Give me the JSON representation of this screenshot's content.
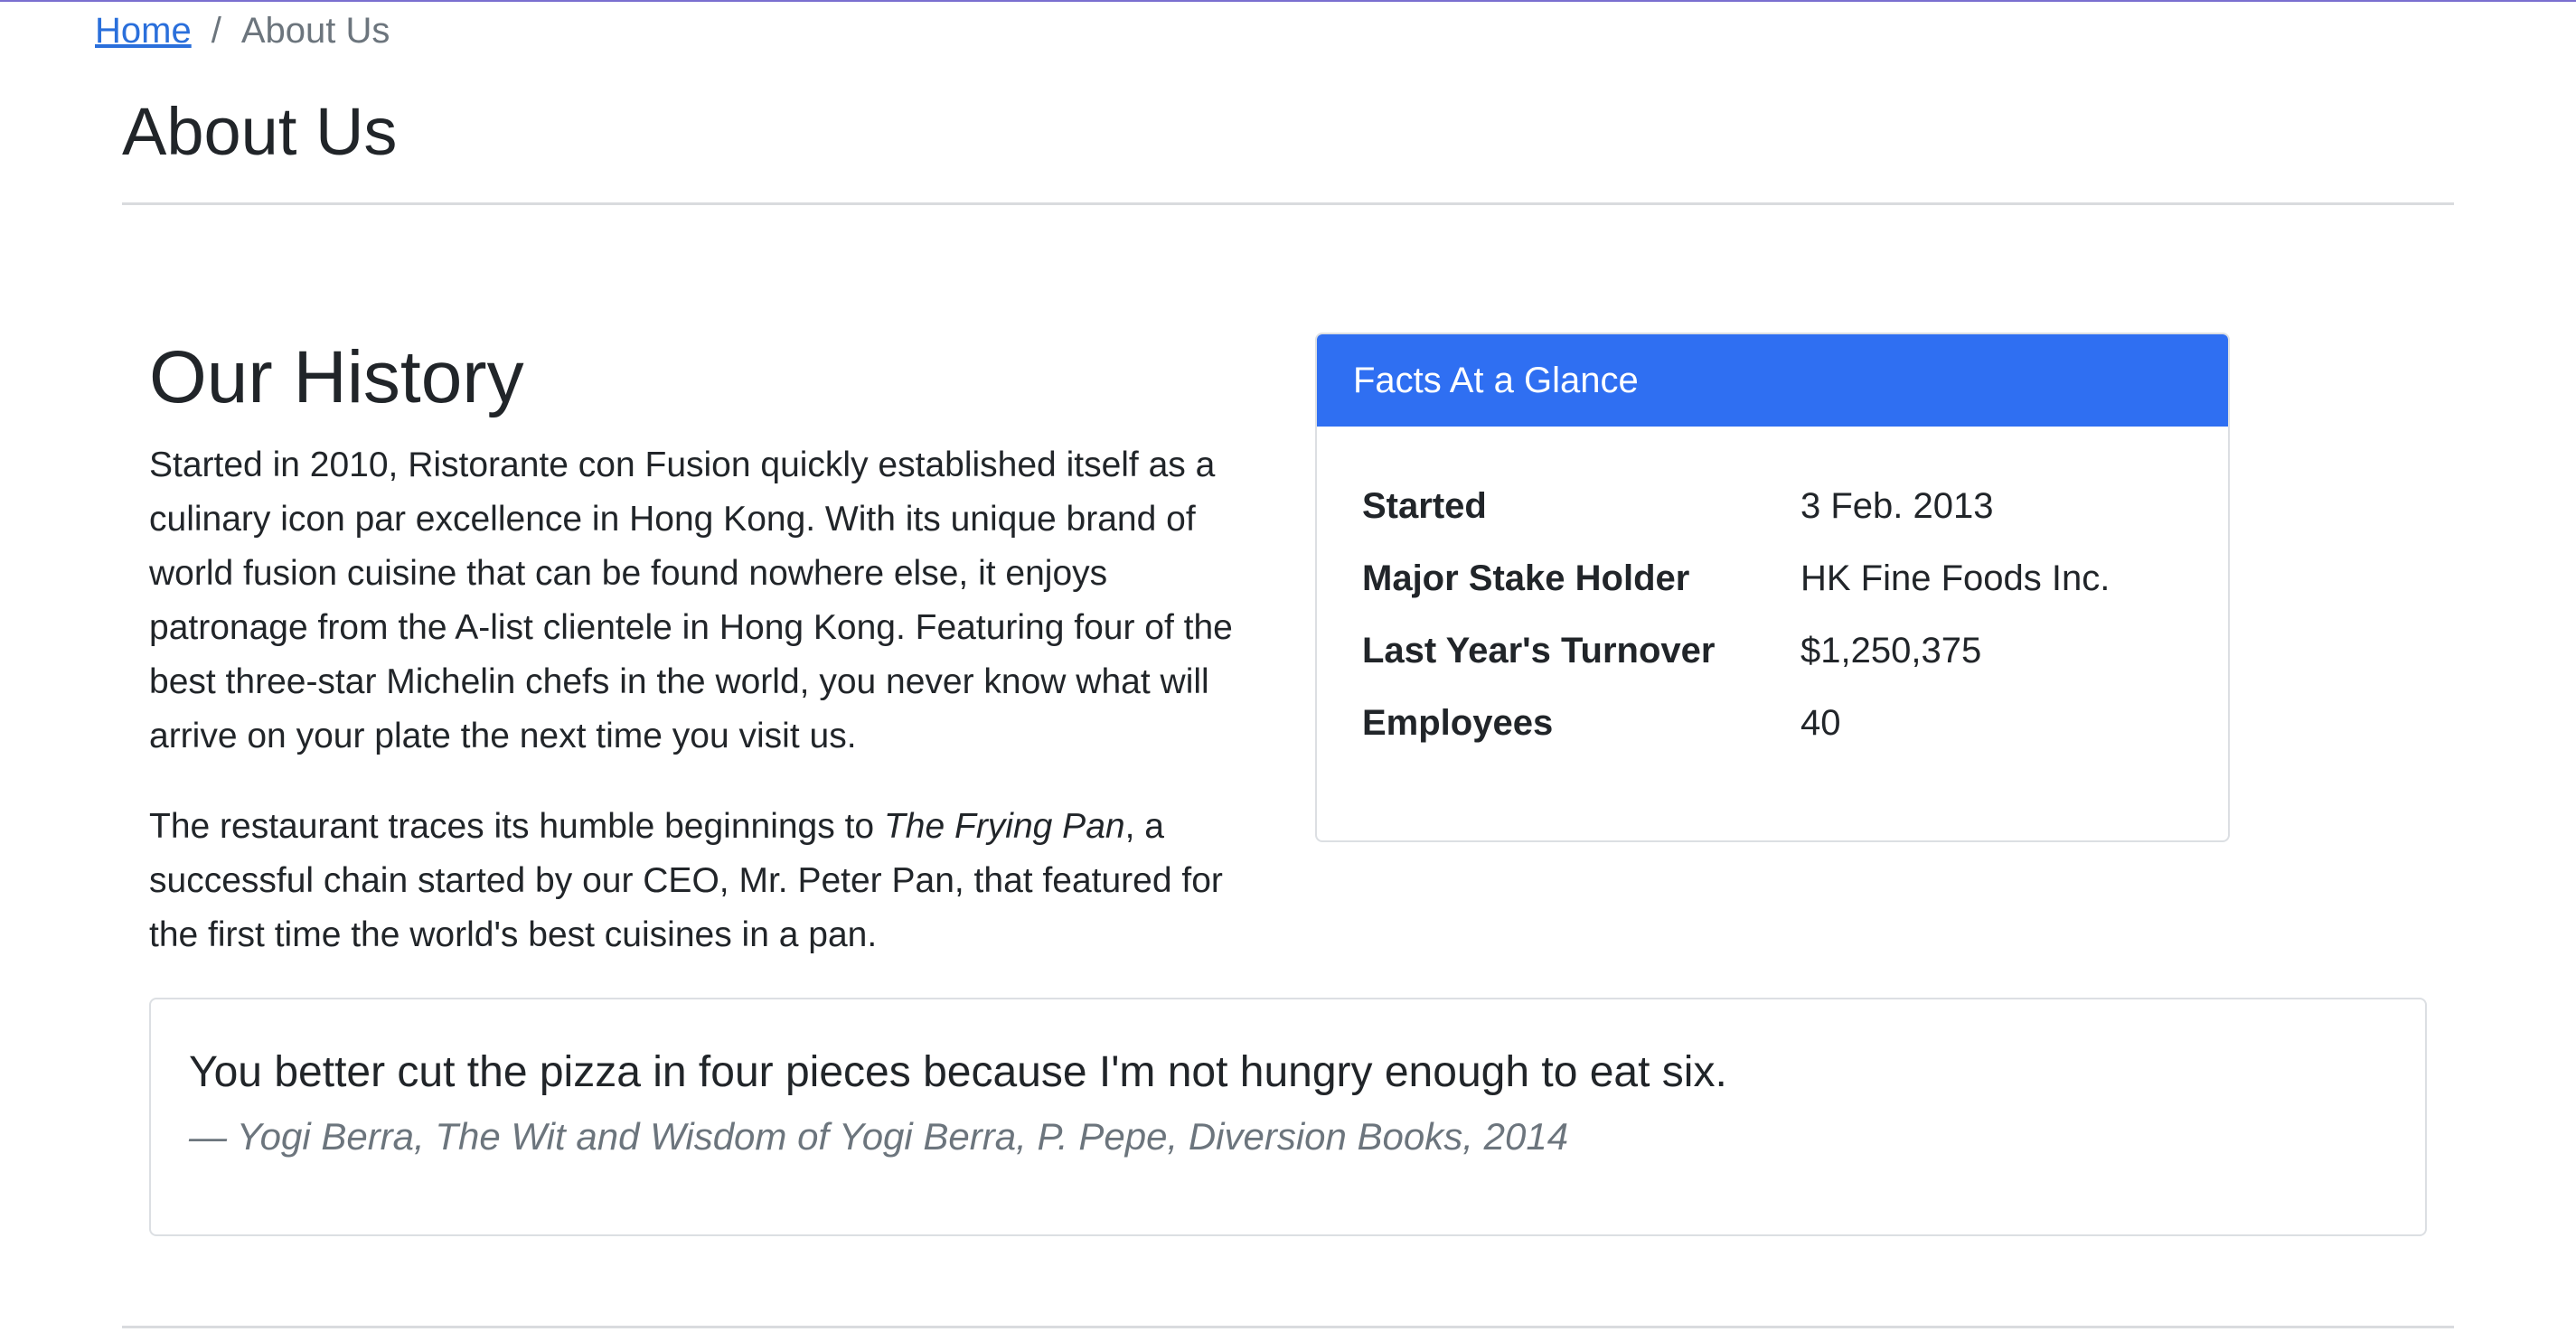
{
  "breadcrumb": {
    "home": "Home",
    "separator": "/",
    "current": "About Us"
  },
  "page": {
    "title": "About Us"
  },
  "history": {
    "title": "Our History",
    "paragraph1": "Started in 2010, Ristorante con Fusion quickly established itself as a culinary icon par excellence in Hong Kong. With its unique brand of world fusion cuisine that can be found nowhere else, it enjoys patronage from the A-list clientele in Hong Kong. Featuring four of the best three-star Michelin chefs in the world, you never know what will arrive on your plate the next time you visit us.",
    "paragraph2_before": "The restaurant traces its humble beginnings to ",
    "paragraph2_italic": "The Frying Pan",
    "paragraph2_after": ", a successful chain started by our CEO, Mr. Peter Pan, that featured for the first time the world's best cuisines in a pan."
  },
  "facts": {
    "header": "Facts At a Glance",
    "items": [
      {
        "label": "Started",
        "value": "3 Feb. 2013"
      },
      {
        "label": "Major Stake Holder",
        "value": "HK Fine Foods Inc."
      },
      {
        "label": "Last Year's Turnover",
        "value": "$1,250,375"
      },
      {
        "label": "Employees",
        "value": "40"
      }
    ]
  },
  "quote": {
    "text": "You better cut the pizza in four pieces because I'm not hungry enough to eat six.",
    "citation": "— Yogi Berra, The Wit and Wisdom of Yogi Berra, P. Pepe, Diversion Books, 2014"
  },
  "colors": {
    "link": "#2a6fdb",
    "card_header": "#2f6ff2",
    "muted_text": "#6c757d",
    "top_border": "#7a6fd0"
  }
}
